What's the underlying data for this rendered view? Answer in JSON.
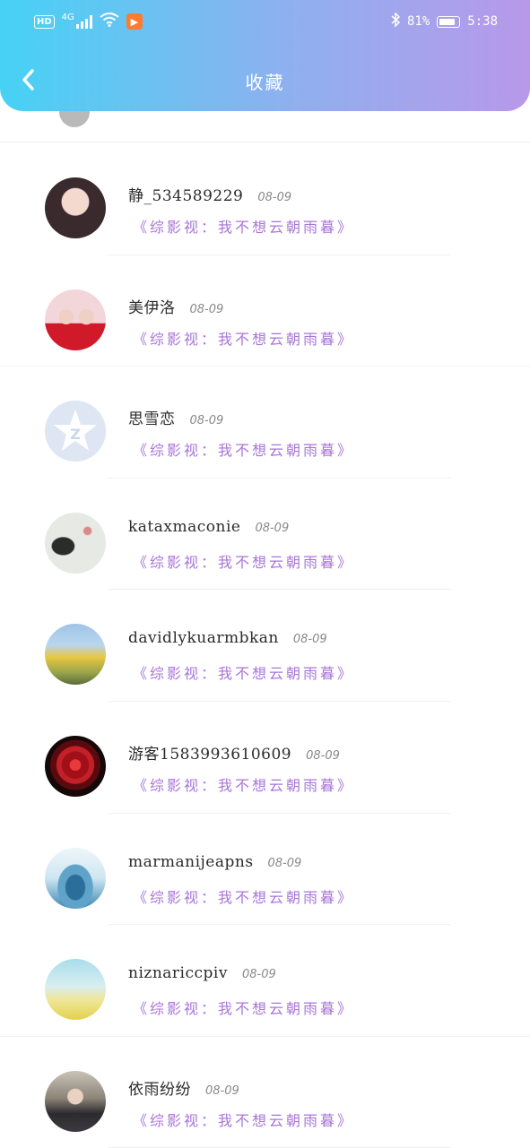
{
  "status_bar": {
    "hd": "HD",
    "network": "4G",
    "bluetooth_icon": "bluetooth-icon",
    "battery_percent": "81%",
    "time": "5:38"
  },
  "header": {
    "back_icon": "chevron-left-icon",
    "title": "收藏"
  },
  "items": [
    {
      "name": "静_534589229",
      "date": "08-09",
      "book": "《综影视：我不想云朝雨暮》",
      "avatar_color": "#3a2a2e"
    },
    {
      "name": "美伊洛",
      "date": "08-09",
      "book": "《综影视：我不想云朝雨暮》",
      "avatar_color": "#f3d6da"
    },
    {
      "name": "思雪恋",
      "date": "08-09",
      "book": "《综影视：我不想云朝雨暮》",
      "avatar_color": "#dde6f2"
    },
    {
      "name": "kataxmaconie",
      "date": "08-09",
      "book": "《综影视：我不想云朝雨暮》",
      "avatar_color": "#e7e9e4"
    },
    {
      "name": "davidlykuarmbkan",
      "date": "08-09",
      "book": "《综影视：我不想云朝雨暮》",
      "avatar_color": "#9fc4e8"
    },
    {
      "name": "游客1583993610609",
      "date": "08-09",
      "book": "《综影视：我不想云朝雨暮》",
      "avatar_color": "#1a1010"
    },
    {
      "name": "marmanijeapns",
      "date": "08-09",
      "book": "《综影视：我不想云朝雨暮》",
      "avatar_color": "#cfe6f2"
    },
    {
      "name": "niznariccpiv",
      "date": "08-09",
      "book": "《综影视：我不想云朝雨暮》",
      "avatar_color": "#bfe3ee"
    },
    {
      "name": "依雨纷纷",
      "date": "08-09",
      "book": "《综影视：我不想云朝雨暮》",
      "avatar_color": "#7a6a5a"
    }
  ]
}
